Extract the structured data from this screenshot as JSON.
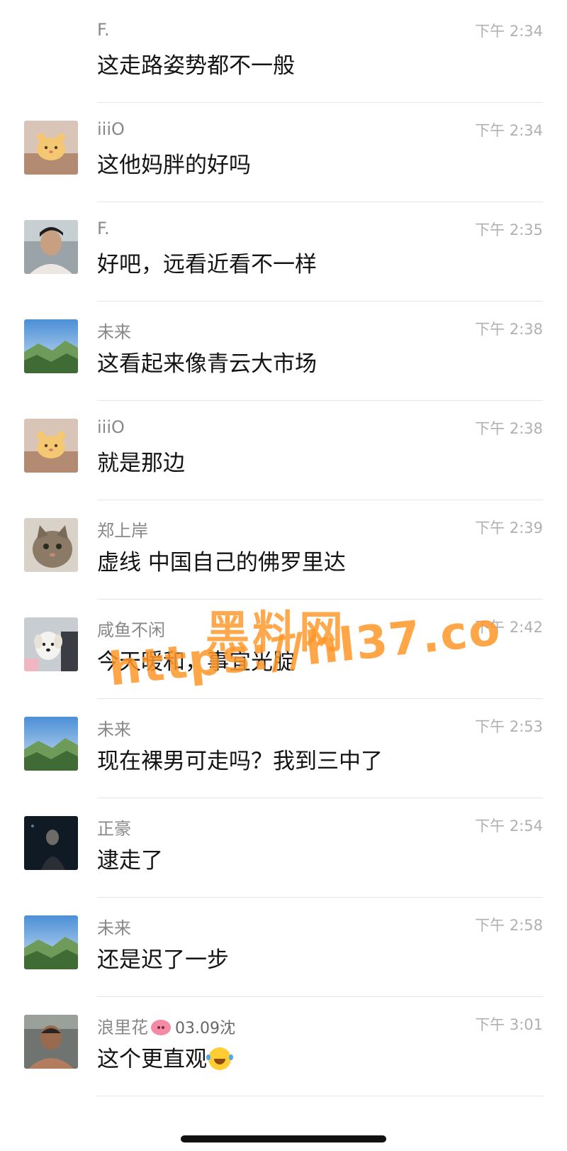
{
  "messages": [
    {
      "name": "F.",
      "time": "下午 2:34",
      "text": "这走路姿势都不一般",
      "avatar": "none"
    },
    {
      "name": "iiiO",
      "time": "下午 2:34",
      "text": "这他妈胖的好吗",
      "avatar": "cartoon-bear-avatar"
    },
    {
      "name": "F.",
      "time": "下午 2:35",
      "text": "好吧，远看近看不一样",
      "avatar": "person-photo-avatar"
    },
    {
      "name": "未来",
      "time": "下午 2:38",
      "text": "这看起来像青云大市场",
      "avatar": "mountain-landscape-avatar"
    },
    {
      "name": "iiiO",
      "time": "下午 2:38",
      "text": "就是那边",
      "avatar": "cartoon-bear-avatar"
    },
    {
      "name": "郑上岸",
      "time": "下午 2:39",
      "text": "虚线 中国自己的佛罗里达",
      "avatar": "cat-photo-avatar"
    },
    {
      "name": "咸鱼不闲",
      "time": "下午 2:42",
      "text": "今天暖和，事宜光腚",
      "avatar": "dog-photo-avatar"
    },
    {
      "name": "未来",
      "time": "下午 2:53",
      "text": "现在裸男可走吗？我到三中了",
      "avatar": "mountain-landscape-avatar"
    },
    {
      "name": "正豪",
      "time": "下午 2:54",
      "text": "逮走了",
      "avatar": "dark-portrait-avatar"
    },
    {
      "name": "未来",
      "time": "下午 2:58",
      "text": "还是迟了一步",
      "avatar": "mountain-landscape-avatar"
    },
    {
      "name": "浪里花",
      "name_suffix": "03.09沈",
      "time": "下午 3:01",
      "text": "这个更直观",
      "avatar": "man-photo-avatar"
    }
  ],
  "watermark": {
    "line1": "黑料网",
    "line2": "https://hl37.co"
  },
  "colors": {
    "name": "#888888",
    "time": "#b0b0b0",
    "text": "#141414",
    "watermark": "#ff9628"
  }
}
